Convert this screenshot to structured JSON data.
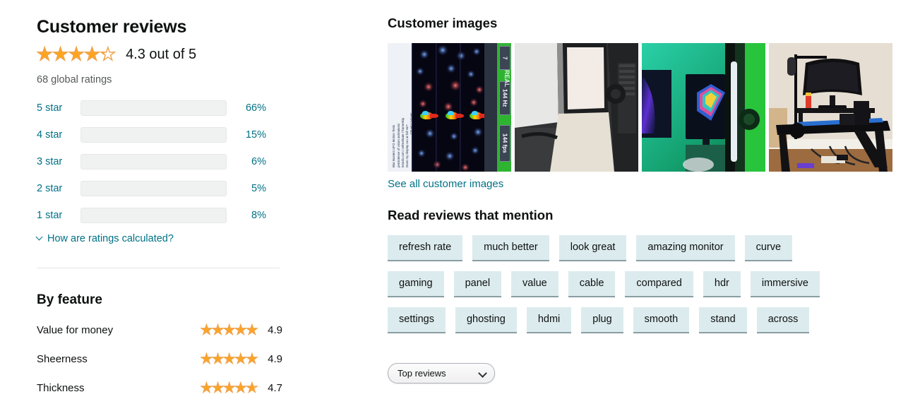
{
  "reviews": {
    "title": "Customer reviews",
    "overall_score_text": "4.3 out of 5",
    "overall_rating": 4.3,
    "global_ratings_text": "68 global ratings",
    "how_calculated_label": "How are ratings calculated?",
    "histogram": [
      {
        "label": "5 star",
        "percent": 66,
        "percent_text": "66%"
      },
      {
        "label": "4 star",
        "percent": 15,
        "percent_text": "15%"
      },
      {
        "label": "3 star",
        "percent": 6,
        "percent_text": "6%"
      },
      {
        "label": "2 star",
        "percent": 5,
        "percent_text": "5%"
      },
      {
        "label": "1 star",
        "percent": 8,
        "percent_text": "8%"
      }
    ]
  },
  "by_feature": {
    "title": "By feature",
    "rows": [
      {
        "name": "Value for money",
        "score": 4.9,
        "score_text": "4.9"
      },
      {
        "name": "Sheerness",
        "score": 4.9,
        "score_text": "4.9"
      },
      {
        "name": "Thickness",
        "score": 4.7,
        "score_text": "4.7"
      }
    ]
  },
  "customer_images": {
    "title": "Customer images",
    "see_all_label": "See all customer images",
    "thumbnails": [
      {
        "alt": "UFO motion blur test pattern on monitor showing 144 Hz and 144 fps",
        "labels": [
          "7",
          "144 Hz",
          "144 fps"
        ]
      },
      {
        "alt": "Monitor packaging box in a dark room"
      },
      {
        "alt": "Gaming desk with green RGB lighting and curved monitor"
      },
      {
        "alt": "Desk setup with curved monitor, microphone arm and cables"
      }
    ]
  },
  "read_reviews": {
    "title": "Read reviews that mention",
    "chip_rows": [
      [
        "refresh rate",
        "much better",
        "look great",
        "amazing monitor",
        "curve"
      ],
      [
        "gaming",
        "panel",
        "value",
        "cable",
        "compared",
        "hdr",
        "immersive"
      ],
      [
        "settings",
        "ghosting",
        "hdmi",
        "plug",
        "smooth",
        "stand",
        "across"
      ]
    ]
  },
  "sort": {
    "selected": "Top reviews"
  },
  "colors": {
    "star": "#ffa41c",
    "link": "#007185",
    "chip_bg": "#dcebee",
    "track_bg": "#f0f2f2",
    "text": "#0f1111",
    "muted": "#565959"
  }
}
